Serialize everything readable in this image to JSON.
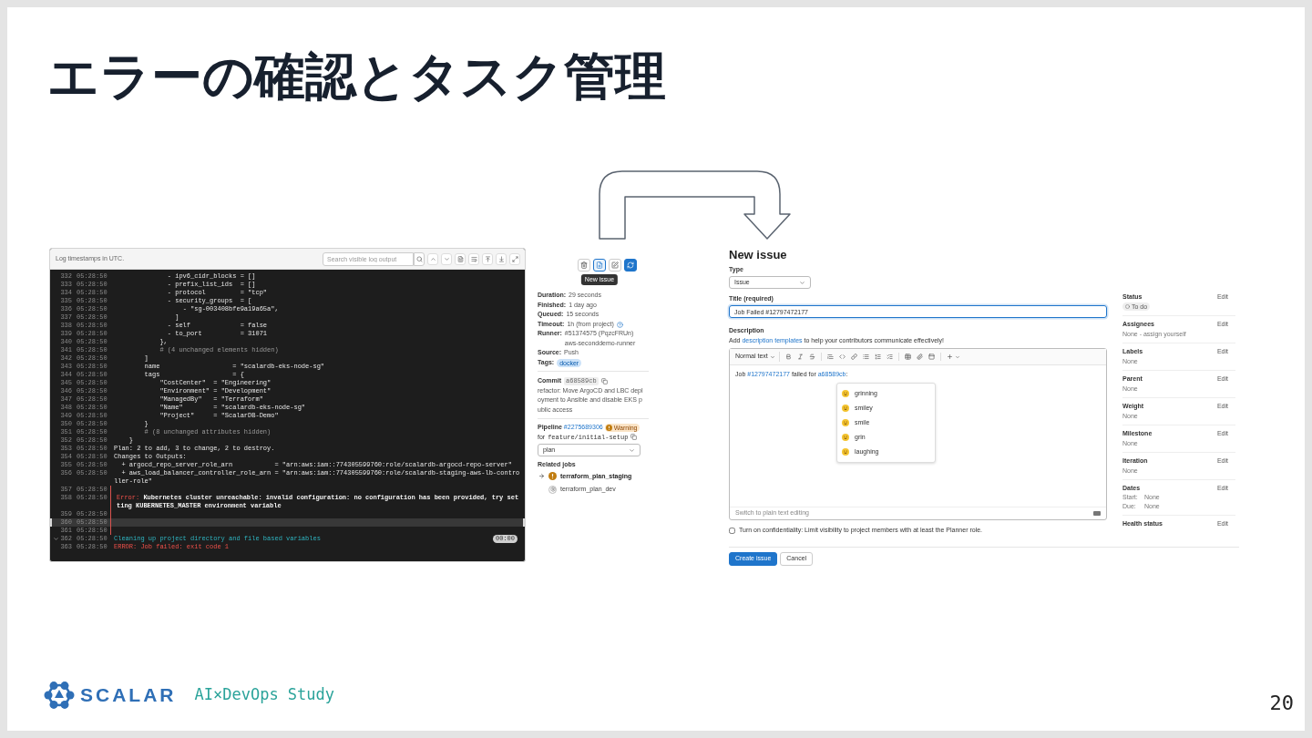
{
  "slide": {
    "title": "エラーの確認とタスク管理",
    "page_number": "20"
  },
  "job_log": {
    "notice": "Log timestamps in UTC.",
    "search": {
      "placeholder": "Search visible log output"
    },
    "lines": [
      {
        "number": "332",
        "time": "05:28:50",
        "text": "              - ipv6_cidr_blocks = []",
        "kind": "code",
        "flagged": false,
        "selected": false
      },
      {
        "number": "333",
        "time": "05:28:50",
        "text": "              - prefix_list_ids  = []",
        "kind": "code",
        "flagged": false,
        "selected": false
      },
      {
        "number": "334",
        "time": "05:28:50",
        "text": "              - protocol         = \"tcp\"",
        "kind": "code",
        "flagged": false,
        "selected": false
      },
      {
        "number": "335",
        "time": "05:28:50",
        "text": "              - security_groups  = [",
        "kind": "code",
        "flagged": false,
        "selected": false
      },
      {
        "number": "336",
        "time": "05:28:50",
        "text": "                  - \"sg-003408bfe9a19a65a\",",
        "kind": "code",
        "flagged": false,
        "selected": false
      },
      {
        "number": "337",
        "time": "05:28:50",
        "text": "                ]",
        "kind": "code",
        "flagged": false,
        "selected": false
      },
      {
        "number": "338",
        "time": "05:28:50",
        "text": "              - self             = false",
        "kind": "code",
        "flagged": false,
        "selected": false
      },
      {
        "number": "339",
        "time": "05:28:50",
        "text": "              - to_port          = 31071",
        "kind": "code",
        "flagged": false,
        "selected": false
      },
      {
        "number": "340",
        "time": "05:28:50",
        "text": "            },",
        "kind": "code",
        "flagged": false,
        "selected": false
      },
      {
        "number": "341",
        "time": "05:28:50",
        "text": "            # (4 unchanged elements hidden)",
        "kind": "comment",
        "flagged": false,
        "selected": false
      },
      {
        "number": "342",
        "time": "05:28:50",
        "text": "        ]",
        "kind": "code",
        "flagged": false,
        "selected": false
      },
      {
        "number": "343",
        "time": "05:28:50",
        "text": "        name                   = \"scalardb-eks-node-sg\"",
        "kind": "code",
        "flagged": false,
        "selected": false
      },
      {
        "number": "344",
        "time": "05:28:50",
        "text": "        tags                   = {",
        "kind": "code",
        "flagged": false,
        "selected": false
      },
      {
        "number": "345",
        "time": "05:28:50",
        "text": "            \"CostCenter\"  = \"Engineering\"",
        "kind": "code",
        "flagged": false,
        "selected": false
      },
      {
        "number": "346",
        "time": "05:28:50",
        "text": "            \"Environment\" = \"Development\"",
        "kind": "code",
        "flagged": false,
        "selected": false
      },
      {
        "number": "347",
        "time": "05:28:50",
        "text": "            \"ManagedBy\"   = \"Terraform\"",
        "kind": "code",
        "flagged": false,
        "selected": false
      },
      {
        "number": "348",
        "time": "05:28:50",
        "text": "            \"Name\"        = \"scalardb-eks-node-sg\"",
        "kind": "code",
        "flagged": false,
        "selected": false
      },
      {
        "number": "349",
        "time": "05:28:50",
        "text": "            \"Project\"     = \"ScalarDB-Demo\"",
        "kind": "code",
        "flagged": false,
        "selected": false
      },
      {
        "number": "350",
        "time": "05:28:50",
        "text": "        }",
        "kind": "code",
        "flagged": false,
        "selected": false
      },
      {
        "number": "351",
        "time": "05:28:50",
        "text": "        # (8 unchanged attributes hidden)",
        "kind": "comment",
        "flagged": false,
        "selected": false
      },
      {
        "number": "352",
        "time": "05:28:50",
        "text": "    }",
        "kind": "code",
        "flagged": false,
        "selected": false
      },
      {
        "number": "353",
        "time": "05:28:50",
        "text": "Plan: 2 to add, 3 to change, 2 to destroy.",
        "kind": "code",
        "flagged": false,
        "selected": false
      },
      {
        "number": "354",
        "time": "05:28:50",
        "text": "Changes to Outputs:",
        "kind": "code",
        "flagged": false,
        "selected": false
      },
      {
        "number": "355",
        "time": "05:28:50",
        "text": "  + argocd_repo_server_role_arn           = \"arn:aws:iam::774305599760:role/scalardb-argocd-repo-server\"",
        "kind": "code",
        "flagged": false,
        "selected": false
      },
      {
        "number": "356",
        "time": "05:28:50",
        "text": "  + aws_load_balancer_controller_role_arn = \"arn:aws:iam::774305599760:role/scalardb-staging-aws-lb-controller-role\"",
        "kind": "code",
        "flagged": false,
        "selected": false
      },
      {
        "number": "357",
        "time": "05:28:50",
        "kind": "blank",
        "flagged": true,
        "selected": false
      },
      {
        "number": "358",
        "time": "05:28:50",
        "label": "Error:",
        "text": " Kubernetes cluster unreachable: invalid configuration: no configuration has been provided, try setting KUBERNETES_MASTER environment variable",
        "kind": "error",
        "flagged": true,
        "selected": false
      },
      {
        "number": "359",
        "time": "05:28:50",
        "kind": "blank",
        "flagged": true,
        "selected": false
      },
      {
        "number": "360",
        "time": "05:28:50",
        "kind": "blank",
        "flagged": true,
        "selected": true
      },
      {
        "number": "361",
        "time": "05:28:50",
        "kind": "blank",
        "flagged": true,
        "selected": false
      },
      {
        "number": "362",
        "time": "05:28:50",
        "text": "Cleaning up project directory and file based variables",
        "kind": "section",
        "expanded": true,
        "duration": "00:00",
        "flagged": false,
        "selected": false
      },
      {
        "number": "363",
        "time": "05:28:50",
        "text": "ERROR: Job failed: exit code 1",
        "kind": "failed",
        "flagged": false,
        "selected": false
      }
    ]
  },
  "job_sidebar": {
    "actions": [
      {
        "kind": "delete",
        "selected": false
      },
      {
        "kind": "new-issue",
        "selected": true
      },
      {
        "kind": "edit",
        "selected": false
      },
      {
        "kind": "retry",
        "selected": false
      }
    ],
    "tooltip": "New issue",
    "details": [
      {
        "label": "Duration:",
        "value": "29 seconds",
        "kind": "text"
      },
      {
        "label": "Finished:",
        "value": "1 day ago",
        "kind": "text"
      },
      {
        "label": "Queued:",
        "value": "15 seconds",
        "kind": "text"
      },
      {
        "label": "Timeout:",
        "value": "1h (from project)",
        "kind": "hint"
      },
      {
        "label": "Runner:",
        "value": "#51374575 (PqzcFRUn) aws-seconddemo-runner",
        "kind": "text"
      },
      {
        "label": "Source:",
        "value": "Push",
        "kind": "text"
      },
      {
        "label": "Tags:",
        "value": "docker",
        "kind": "tag"
      }
    ],
    "commit": {
      "label": "Commit",
      "sha": "a68589cb",
      "message": "refactor: Move ArgoCD and LBC deployment to Ansible and disable EKS public access"
    },
    "pipeline": {
      "label": "Pipeline",
      "id": "#2275689306",
      "status": "Warning",
      "ref_prefix": "for",
      "ref": "feature/initial-setup",
      "stage": "plan"
    },
    "related_jobs": {
      "title": "Related jobs",
      "jobs": [
        {
          "name": "terraform_plan_staging",
          "kind": "warning",
          "selected": true
        },
        {
          "name": "terraform_plan_dev",
          "kind": "manual",
          "selected": false
        }
      ]
    }
  },
  "new_issue": {
    "heading": "New issue",
    "type": {
      "label": "Type",
      "value": "Issue"
    },
    "title_field": {
      "label": "Title (required)",
      "value": "Job Failed #12797472177"
    },
    "description": {
      "label": "Description",
      "hint_before": "Add ",
      "hint_link": "description templates",
      "hint_after": " to help your contributors communicate effectively!"
    },
    "editor": {
      "text_style": "Normal text",
      "content": [
        {
          "text": "Job ",
          "kind": "text"
        },
        {
          "text": "#12797472177",
          "kind": "link"
        },
        {
          "text": " failed for ",
          "kind": "text"
        },
        {
          "text": "a68589cb",
          "kind": "link"
        },
        {
          "text": ":",
          "kind": "text"
        }
      ],
      "emoji_suggestions": [
        "grinning",
        "smiley",
        "smile",
        "grin",
        "laughing"
      ],
      "footer": "Switch to plain text editing"
    },
    "confidential": {
      "label": "Turn on confidentiality: Limit visibility to project members with at least the Planner role.",
      "checked": false
    },
    "buttons": [
      {
        "label": "Create issue",
        "kind": "primary"
      },
      {
        "label": "Cancel",
        "kind": "default"
      }
    ],
    "sidebar": [
      {
        "label": "Status",
        "action": "Edit",
        "kind": "status",
        "values": [
          "To do"
        ]
      },
      {
        "label": "Assignees",
        "action": "Edit",
        "kind": "text",
        "values": [
          "None - assign yourself"
        ]
      },
      {
        "label": "Labels",
        "action": "Edit",
        "kind": "text",
        "values": [
          "None"
        ]
      },
      {
        "label": "Parent",
        "action": "Edit",
        "kind": "text",
        "values": [
          "None"
        ]
      },
      {
        "label": "Weight",
        "action": "Edit",
        "kind": "text",
        "values": [
          "None"
        ]
      },
      {
        "label": "Milestone",
        "action": "Edit",
        "kind": "text",
        "values": [
          "None"
        ]
      },
      {
        "label": "Iteration",
        "action": "Edit",
        "kind": "text",
        "values": [
          "None"
        ]
      },
      {
        "label": "Dates",
        "action": "Edit",
        "kind": "dates",
        "fields": [
          {
            "label": "Start:",
            "value": "None"
          },
          {
            "label": "Due:",
            "value": "None"
          }
        ]
      },
      {
        "label": "Health status",
        "action": "Edit",
        "kind": "text"
      }
    ]
  },
  "footer": {
    "brand": "SCALAR",
    "event": "AI×DevOps Study"
  }
}
